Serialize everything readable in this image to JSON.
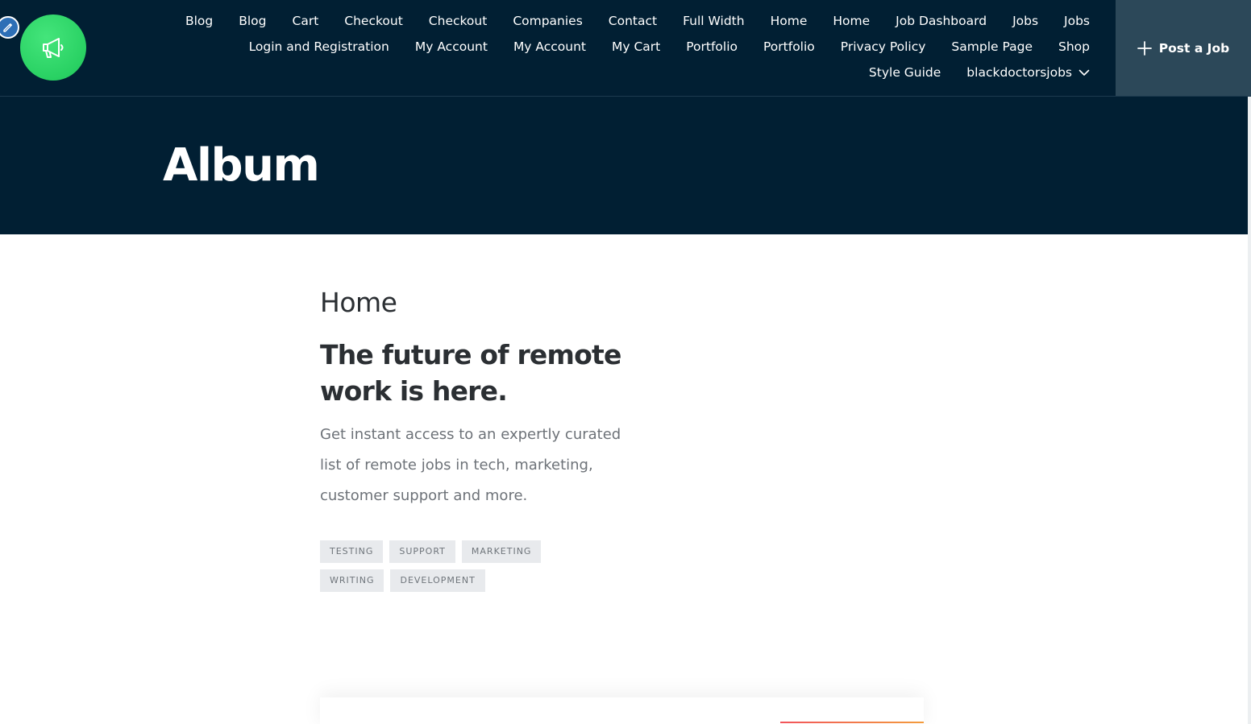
{
  "header": {
    "nav_row1": [
      {
        "label": "Blog"
      },
      {
        "label": "Blog"
      },
      {
        "label": "Cart"
      },
      {
        "label": "Checkout"
      },
      {
        "label": "Checkout"
      },
      {
        "label": "Companies"
      },
      {
        "label": "Contact"
      },
      {
        "label": "Full Width"
      },
      {
        "label": "Home"
      },
      {
        "label": "Home"
      },
      {
        "label": "Job Dashboard"
      },
      {
        "label": "Jobs"
      },
      {
        "label": "Jobs"
      }
    ],
    "nav_row2": [
      {
        "label": "Login and Registration"
      },
      {
        "label": "My Account"
      },
      {
        "label": "My Account"
      },
      {
        "label": "My Cart"
      },
      {
        "label": "Portfolio"
      },
      {
        "label": "Portfolio"
      },
      {
        "label": "Privacy Policy"
      },
      {
        "label": "Sample Page"
      },
      {
        "label": "Shop"
      },
      {
        "label": "Style Guide"
      }
    ],
    "dropdown_label": "blackdoctorsjobs",
    "post_job_label": "Post a Job"
  },
  "page": {
    "title": "Album"
  },
  "content": {
    "section_heading": "Home",
    "headline": "The future of remote work is here.",
    "lead": "Get instant access to an expertly curated list of remote jobs in tech, marketing, customer support and more.",
    "tags": [
      "TESTING",
      "SUPPORT",
      "MARKETING",
      "WRITING",
      "DEVELOPMENT"
    ]
  },
  "colors": {
    "header_bg": "#011f33",
    "post_job_bg": "#2c4859",
    "logo_green": "#2fdc6b",
    "edit_badge": "#2d6fb6",
    "text_dark": "#2b2f33",
    "text_muted": "#6d7278",
    "tag_bg": "#e8eaed"
  },
  "icons": {
    "edit": "pencil-icon",
    "logo": "megaphone-icon",
    "post_job": "plus-icon",
    "dropdown": "chevron-down-icon"
  }
}
